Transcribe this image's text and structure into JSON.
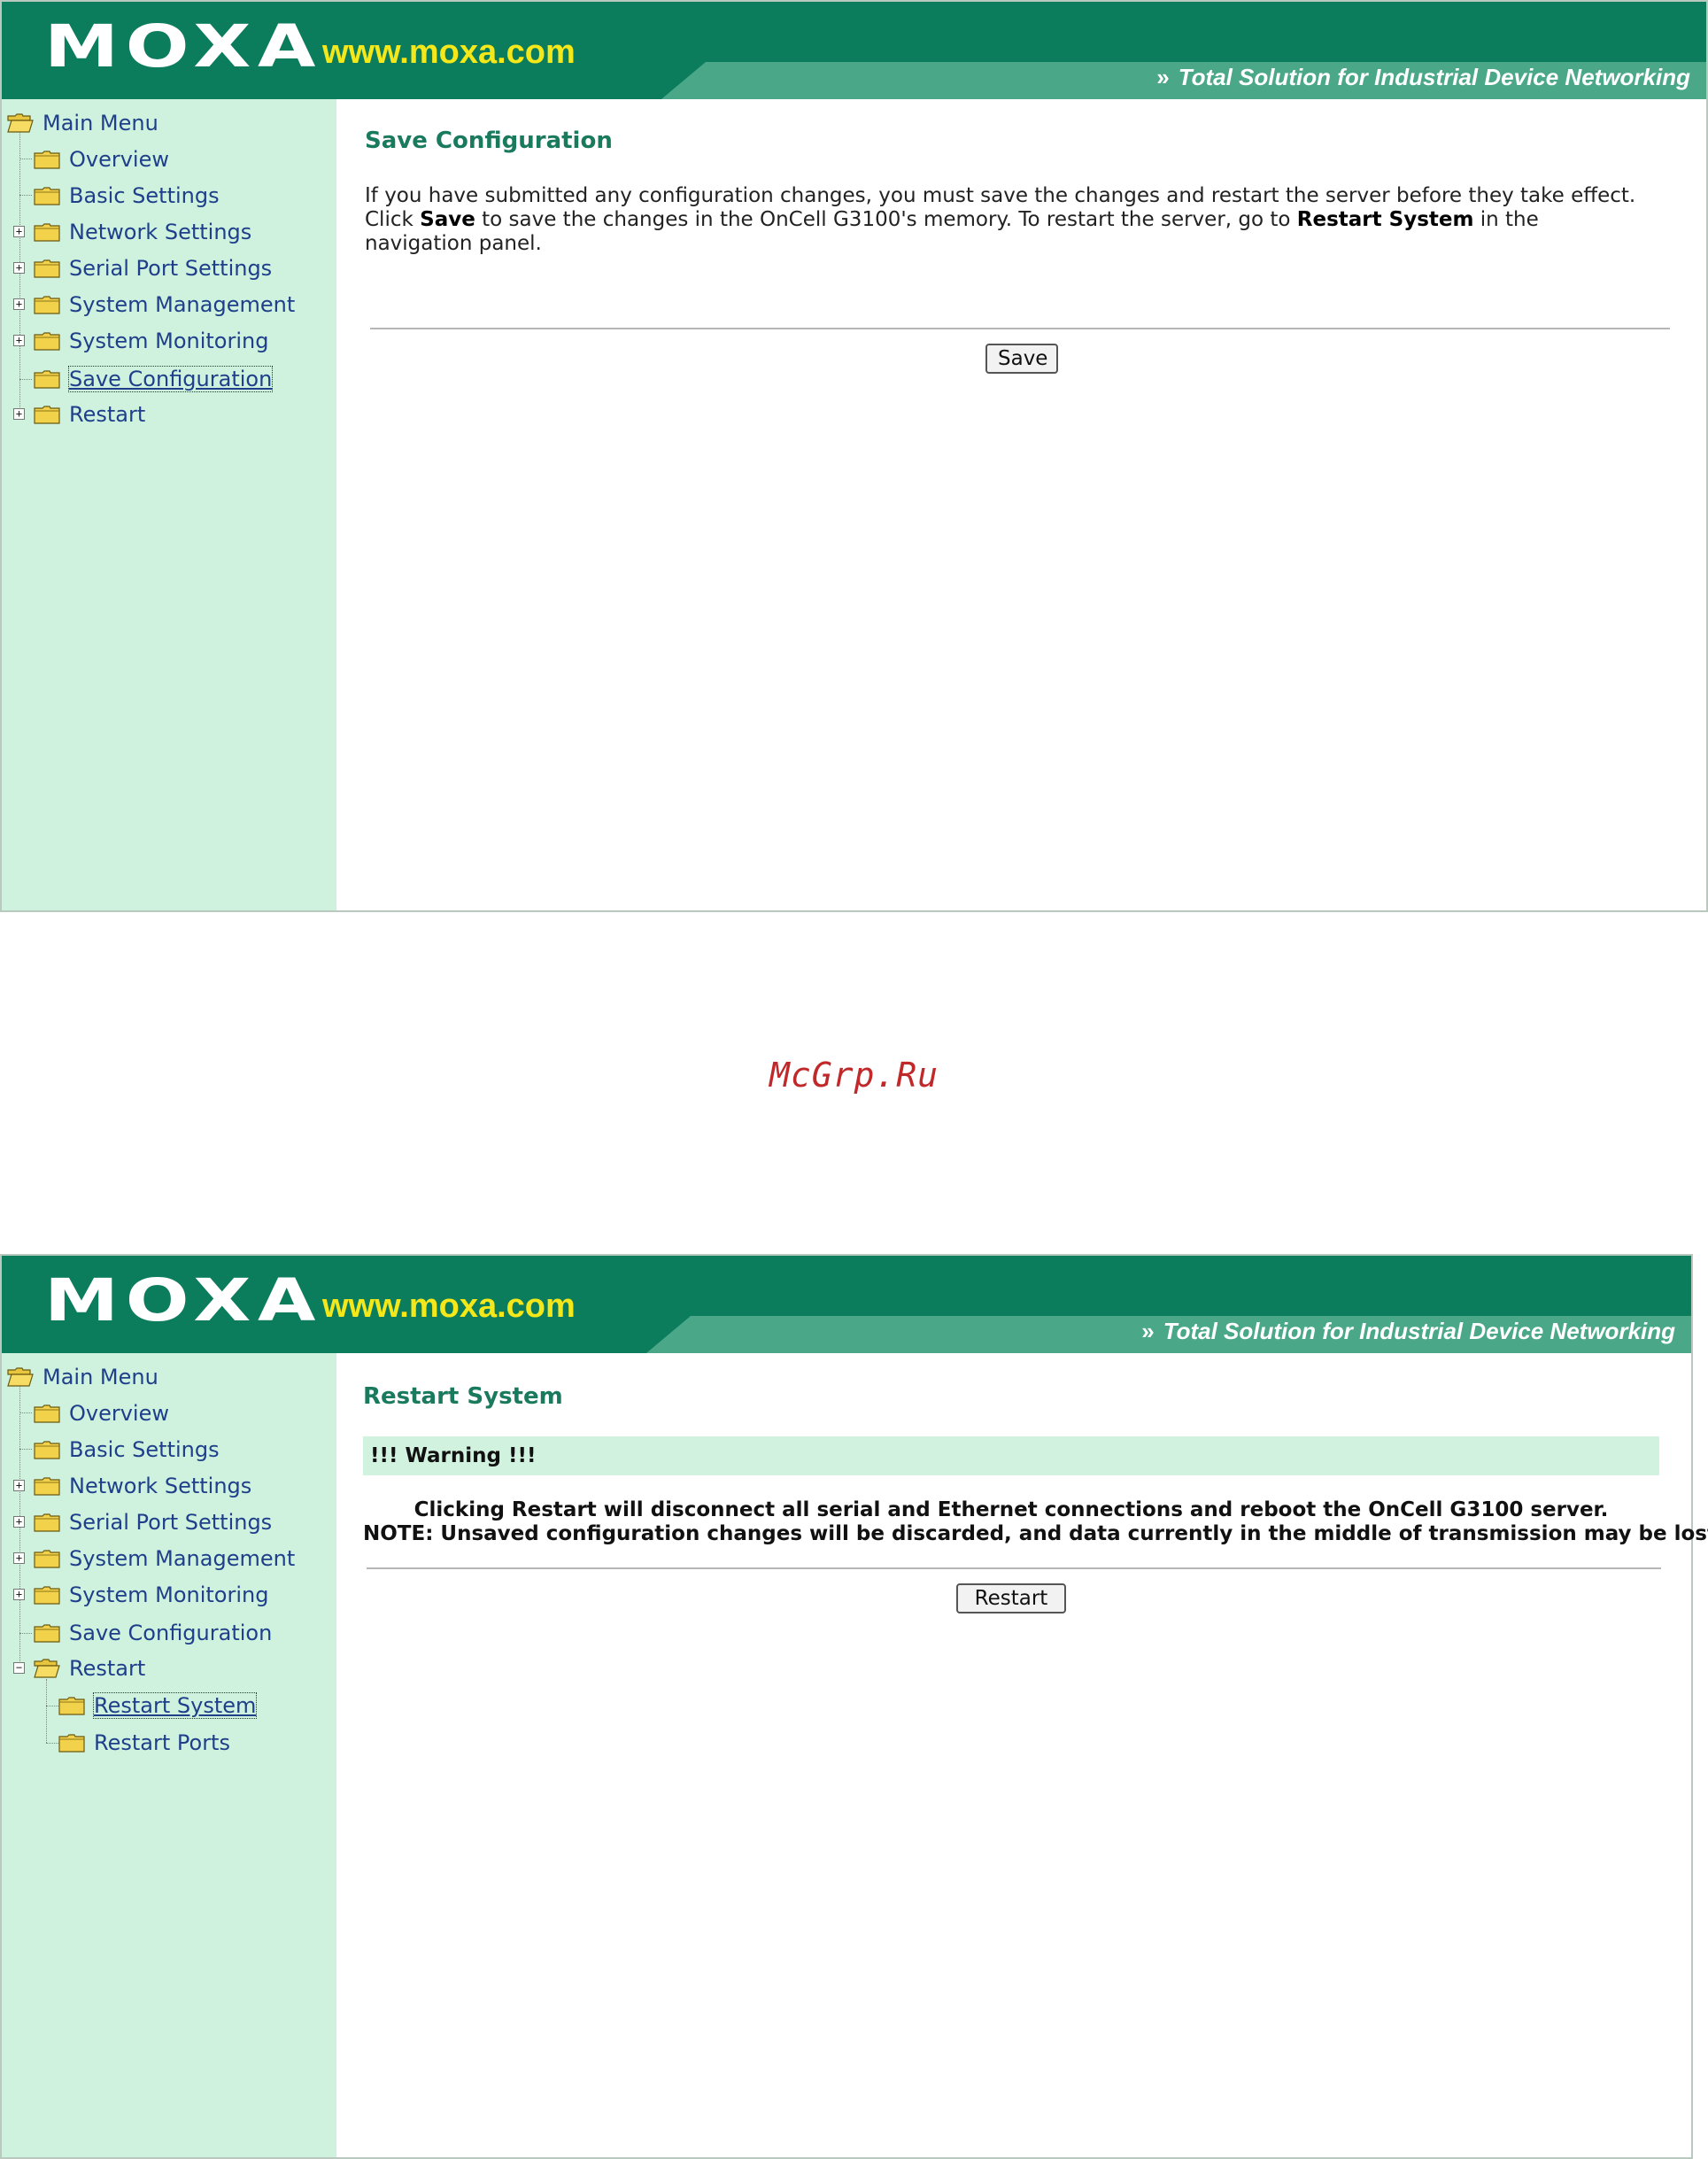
{
  "header": {
    "logo": "MOXA",
    "site": "www.moxa.com",
    "chevron": "»",
    "tagline": "Total Solution for Industrial Device Networking"
  },
  "watermark": "McGrp.Ru",
  "shot1": {
    "tree": [
      {
        "label": "Main Menu"
      },
      {
        "label": "Overview"
      },
      {
        "label": "Basic Settings"
      },
      {
        "label": "Network Settings"
      },
      {
        "label": "Serial Port Settings"
      },
      {
        "label": "System Management"
      },
      {
        "label": "System Monitoring"
      },
      {
        "label": "Save Configuration"
      },
      {
        "label": "Restart"
      }
    ],
    "title": "Save Configuration",
    "line1": "If you have submitted any configuration changes, you must save the changes and restart the server before they take effect.",
    "line2_a": "Click ",
    "line2_b": "Save",
    "line2_c": " to save the changes in the OnCell G3100's memory. To restart the server, go to ",
    "line2_d": "Restart System",
    "line2_e": " in the",
    "line3": "navigation panel.",
    "button": "Save"
  },
  "shot2": {
    "tree": [
      {
        "label": "Main Menu"
      },
      {
        "label": "Overview"
      },
      {
        "label": "Basic Settings"
      },
      {
        "label": "Network Settings"
      },
      {
        "label": "Serial Port Settings"
      },
      {
        "label": "System Management"
      },
      {
        "label": "System Monitoring"
      },
      {
        "label": "Save Configuration"
      },
      {
        "label": "Restart"
      },
      {
        "label": "Restart System"
      },
      {
        "label": "Restart Ports"
      }
    ],
    "title": "Restart System",
    "warning": "!!! Warning !!!",
    "msg1": "Clicking Restart will disconnect all serial and Ethernet connections and reboot the OnCell G3100 server.",
    "msg2": "NOTE: Unsaved configuration changes will be discarded, and data currently in the middle of transmission may be lost.",
    "button": "Restart"
  }
}
